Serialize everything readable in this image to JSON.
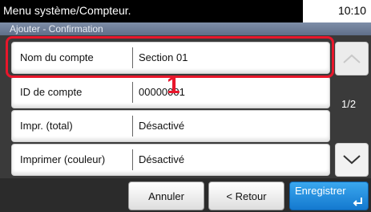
{
  "header": {
    "title": "Menu système/Compteur.",
    "time": "10:10"
  },
  "subheader": {
    "title": "Ajouter - Confirmation"
  },
  "rows": [
    {
      "label": "Nom du compte",
      "value": "Section 01"
    },
    {
      "label": "ID de compte",
      "value": "00000001"
    },
    {
      "label": "Impr. (total)",
      "value": "Désactivé"
    },
    {
      "label": "Imprimer (couleur)",
      "value": "Désactivé"
    }
  ],
  "annotation": {
    "callout": "1",
    "color": "#e8162b"
  },
  "pagination": {
    "indicator": "1/2"
  },
  "footer": {
    "cancel_label": "Annuler",
    "back_label": "< Retour",
    "save_label": "Enregistrer"
  },
  "colors": {
    "accent": "#1479cf",
    "highlight": "#e8162b"
  }
}
